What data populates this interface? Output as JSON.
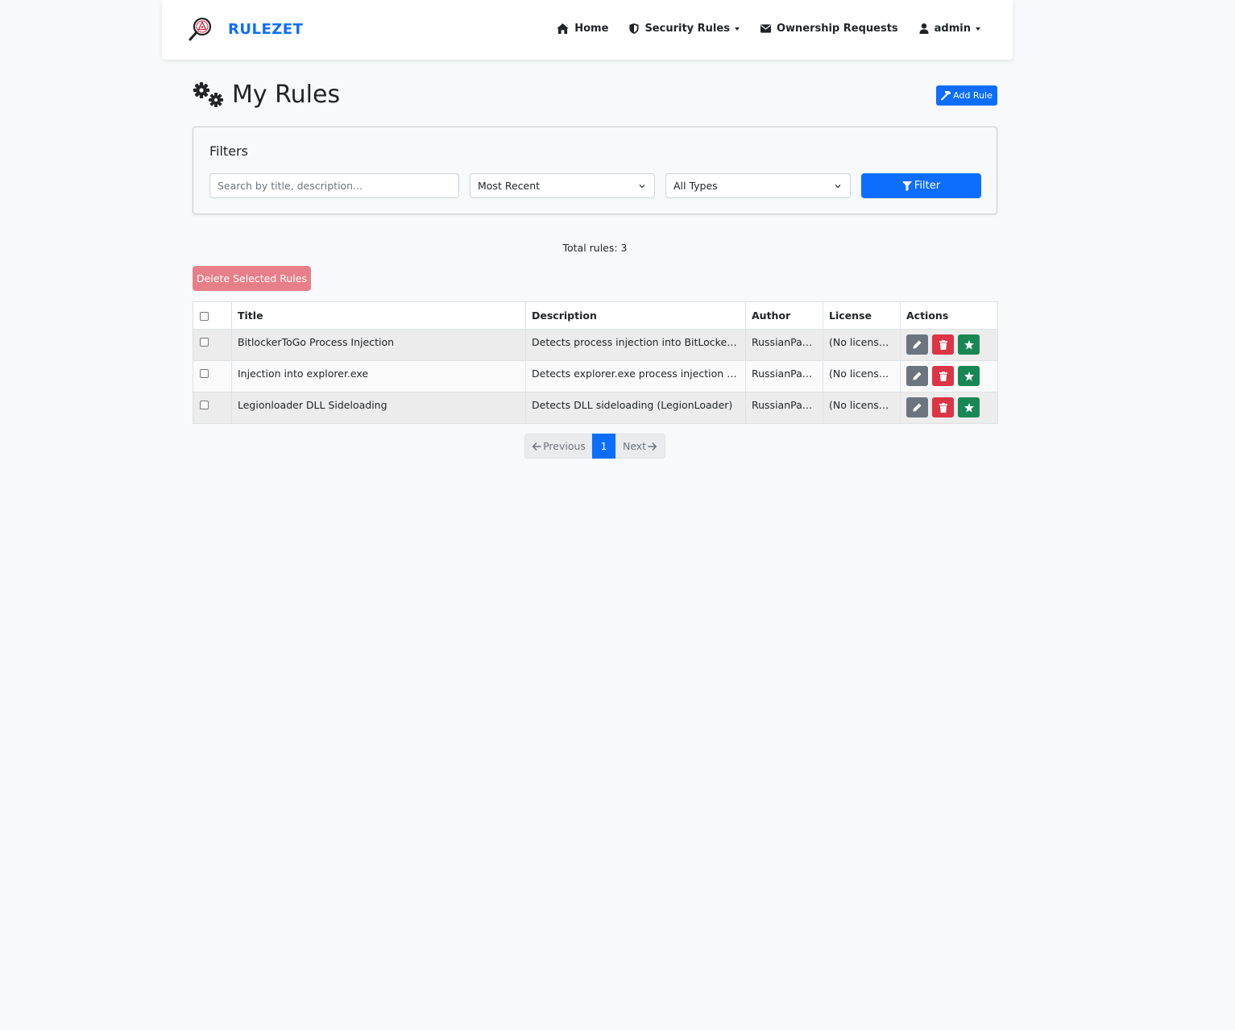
{
  "brand": {
    "name": "RULEZET"
  },
  "nav": {
    "home": "Home",
    "security_rules": "Security Rules",
    "ownership_requests": "Ownership Requests",
    "user": "admin"
  },
  "page": {
    "title": "My Rules",
    "add_rule_label": "Add Rule"
  },
  "filters": {
    "heading": "Filters",
    "search_placeholder": "Search by title, description...",
    "sort_selected": "Most Recent",
    "type_selected": "All Types",
    "filter_label": "Filter"
  },
  "summary": {
    "total": "Total rules: 3"
  },
  "bulk": {
    "delete_label": "Delete Selected Rules"
  },
  "table": {
    "headers": [
      "Title",
      "Description",
      "Author",
      "License",
      "Actions"
    ],
    "rows": [
      {
        "title": "BitlockerToGo Process Injection",
        "description": "Detects process injection into BitLockerToGo.exe",
        "author": "RussianPanda",
        "license": "(No license provided)"
      },
      {
        "title": "Injection into explorer.exe",
        "description": "Detects explorer.exe process injection (LegionLoader)",
        "author": "RussianPanda",
        "license": "(No license provided)"
      },
      {
        "title": "Legionloader DLL Sideloading",
        "description": "Detects DLL sideloading (LegionLoader)",
        "author": "RussianPanda",
        "license": "(No license provided)"
      }
    ]
  },
  "pagination": {
    "previous": "Previous",
    "current": "1",
    "next": "Next"
  },
  "colors": {
    "primary": "#0d6efd",
    "danger": "#dc3545",
    "secondary": "#6c757d",
    "success": "#198754"
  },
  "icons": {
    "brand": "magnifier-logo-icon",
    "home": "home-icon",
    "security": "shield-icon",
    "ownership": "envelope-icon",
    "user": "user-icon",
    "title": "gears-icon",
    "add": "hammer-icon",
    "filter": "funnel-icon",
    "edit": "pencil-icon",
    "delete": "trash-icon",
    "favorite": "star-icon"
  }
}
